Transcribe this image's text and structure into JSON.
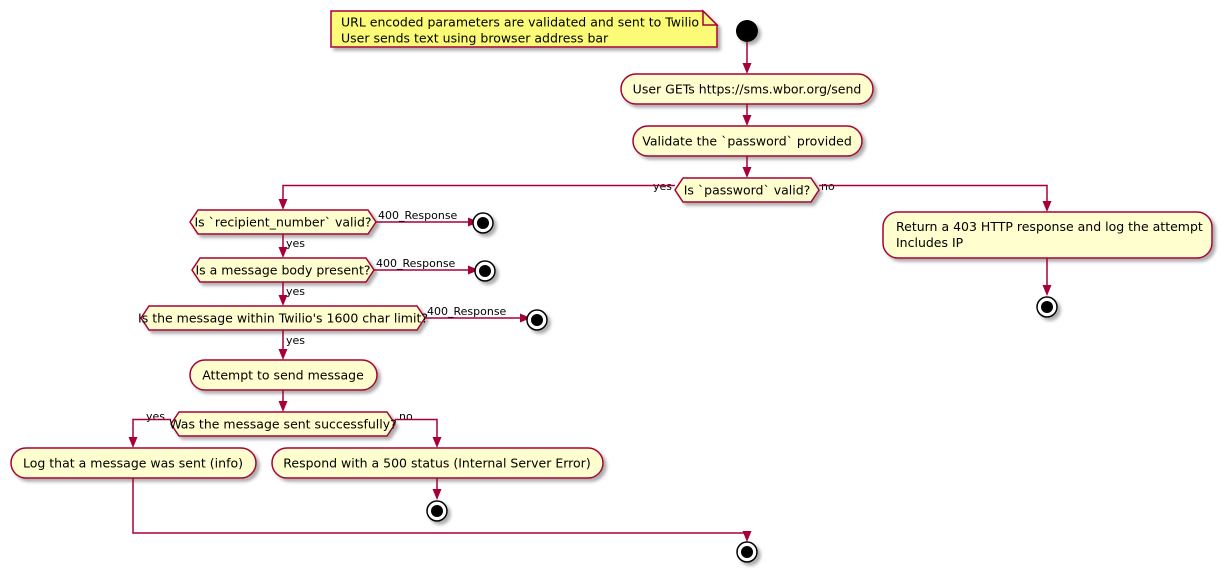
{
  "diagram": {
    "title": "SMS send endpoint activity diagram",
    "type": "activity-diagram",
    "colors": {
      "node_fill": "#FEFECE",
      "node_border": "#A80036",
      "note_fill": "#FBFB77",
      "edge": "#A80036",
      "text": "#000000",
      "background": "#FFFFFF"
    }
  },
  "note": {
    "line1": "URL encoded parameters are validated and sent to Twilio",
    "line2": "User sends text using browser address bar"
  },
  "nodes": {
    "start": "start-node",
    "get_request": "User GETs https://sms.wbor.org/send",
    "validate_password": "Validate the `password` provided",
    "forbidden_response": {
      "line1": "Return a 403 HTTP response and log the attempt",
      "line2": "Includes IP"
    },
    "attempt_send": "Attempt to send message",
    "log_sent": "Log that a message was sent (info)",
    "server_error": "Respond with a 500 status (Internal Server Error)"
  },
  "decisions": {
    "password_valid": "Is `password` valid?",
    "recipient_valid": "Is `recipient_number` valid?",
    "body_present": "Is a message body present?",
    "char_limit": "Is the message within Twilio's 1600 char limit?",
    "sent_ok": "Was the message sent successfully?"
  },
  "edge_labels": {
    "password_yes": "yes",
    "password_no": "no",
    "recipient_no": "400_Response",
    "recipient_yes": "yes",
    "body_no": "400_Response",
    "body_yes": "yes",
    "limit_no": "400_Response",
    "limit_yes": "yes",
    "sent_yes": "yes",
    "sent_no": "no"
  }
}
